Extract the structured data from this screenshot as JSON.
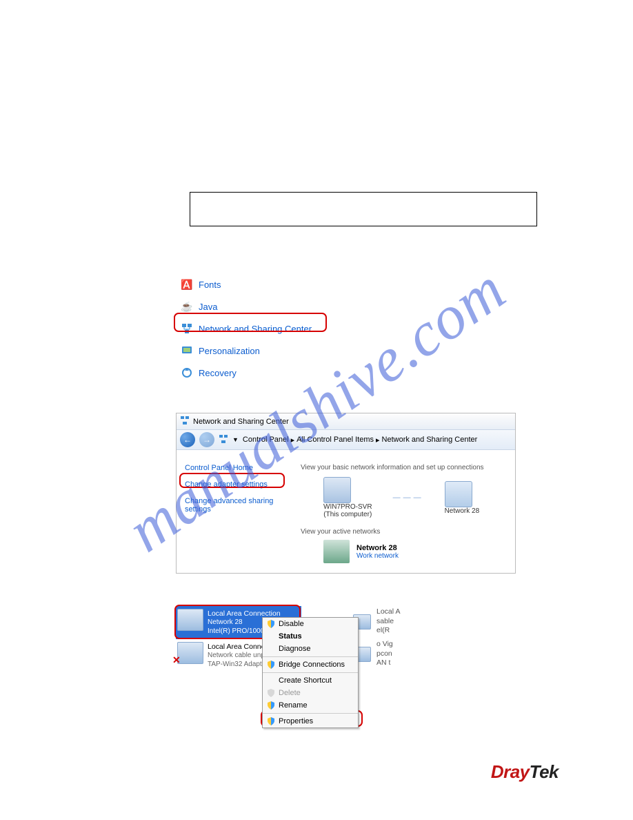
{
  "watermark": "manualshive.com",
  "control_panel_items": [
    {
      "label": "Fonts"
    },
    {
      "label": "Java"
    },
    {
      "label": "Network and Sharing Center"
    },
    {
      "label": "Personalization"
    },
    {
      "label": "Recovery"
    }
  ],
  "net_center": {
    "title": "Network and Sharing Center",
    "breadcrumbs": [
      "Control Panel",
      "All Control Panel Items",
      "Network and Sharing Center"
    ],
    "left_links": {
      "home": "Control Panel Home",
      "adapter": "Change adapter settings",
      "advanced": "Change advanced sharing settings"
    },
    "right": {
      "heading": "View your basic network information and set up connections",
      "pc_name": "WIN7PRO-SVR",
      "pc_sub": "(This computer)",
      "net_name": "Network 28",
      "active_label": "View your active networks",
      "active_name": "Network 28",
      "active_type": "Work network"
    }
  },
  "connections": {
    "selected": {
      "name": "Local Area Connection",
      "net": "Network 28",
      "adapter": "Intel(R) PRO/1000"
    },
    "other": {
      "name": "Local Area Connec",
      "status": "Network cable unp",
      "adapter": "TAP-Win32 Adapt"
    }
  },
  "peek": {
    "l1": "Local A",
    "l2": "sable",
    "l3": "el(R",
    "l4": "o Vig",
    "l5": "pcon",
    "l6": "AN t"
  },
  "context_menu": {
    "disable": "Disable",
    "status": "Status",
    "diagnose": "Diagnose",
    "bridge": "Bridge Connections",
    "shortcut": "Create Shortcut",
    "delete": "Delete",
    "rename": "Rename",
    "properties": "Properties"
  },
  "logo": {
    "red": "Dray",
    "black": "Tek"
  }
}
